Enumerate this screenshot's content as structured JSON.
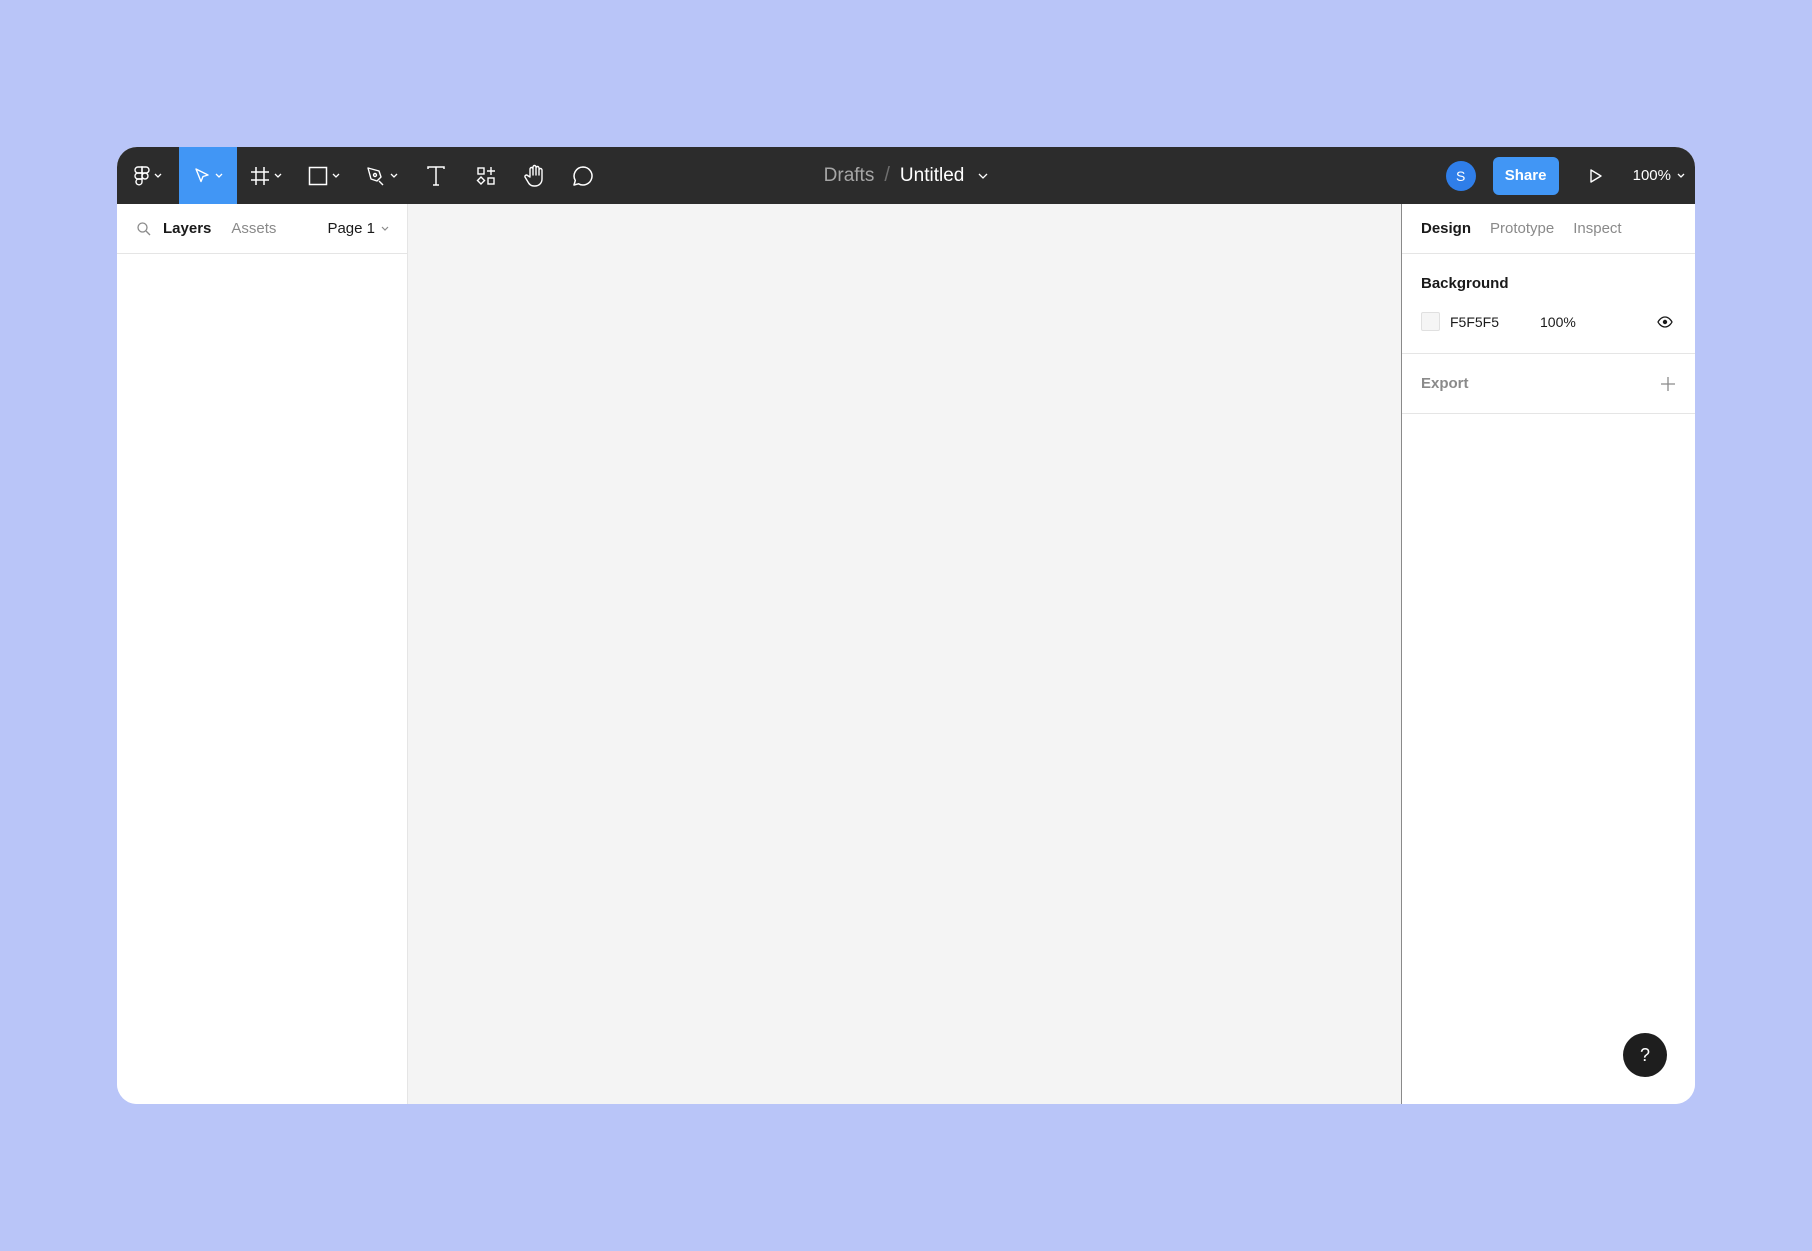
{
  "toolbar": {
    "tools": [
      {
        "name": "main-menu",
        "icon": "figma-logo-icon"
      },
      {
        "name": "move",
        "icon": "move-cursor-icon"
      },
      {
        "name": "frame",
        "icon": "frame-hash-icon"
      },
      {
        "name": "shape",
        "icon": "rectangle-icon"
      },
      {
        "name": "pen",
        "icon": "pen-icon"
      },
      {
        "name": "text",
        "icon": "text-icon"
      },
      {
        "name": "resources",
        "icon": "resources-icon"
      },
      {
        "name": "hand",
        "icon": "hand-icon"
      },
      {
        "name": "comment",
        "icon": "comment-icon"
      }
    ],
    "accent_color": "#4196f5",
    "breadcrumb": "Drafts",
    "separator": "/",
    "file_title": "Untitled",
    "avatar_initial": "S",
    "share_label": "Share",
    "zoom_level": "100%"
  },
  "left_panel": {
    "tabs": [
      {
        "label": "Layers",
        "active": true
      },
      {
        "label": "Assets",
        "active": false
      }
    ],
    "page_select": "Page 1"
  },
  "right_panel": {
    "tabs": [
      {
        "label": "Design",
        "active": true
      },
      {
        "label": "Prototype",
        "active": false
      },
      {
        "label": "Inspect",
        "active": false
      }
    ],
    "background": {
      "title": "Background",
      "color_hex": "F5F5F5",
      "opacity": "100%"
    },
    "export": {
      "title": "Export"
    },
    "help_label": "?"
  }
}
